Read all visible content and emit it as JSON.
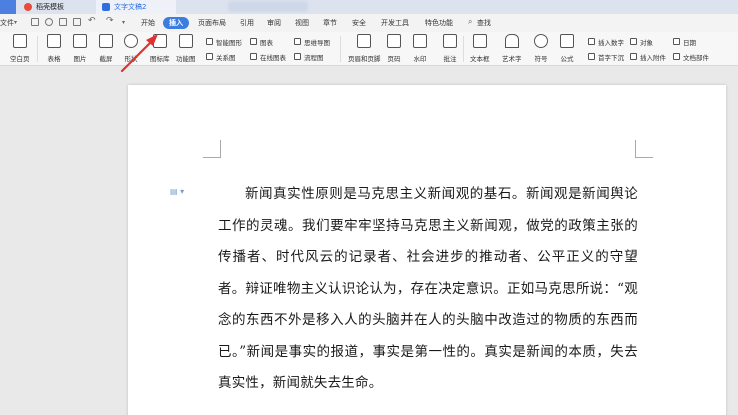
{
  "tabs": {
    "home_label": "",
    "tab1": "稻壳模板",
    "tab2": "文字文稿2"
  },
  "quick_access": {
    "file": "文件",
    "more": "▾"
  },
  "menu": {
    "items": [
      "开始",
      "插入",
      "页面布局",
      "引用",
      "审阅",
      "视图",
      "章节",
      "安全",
      "开发工具",
      "特色功能",
      "查找"
    ],
    "active": "插入"
  },
  "ribbon": {
    "blank_page": "空白页",
    "table": "表格",
    "image": "图片",
    "screenshot": "截屏",
    "shape": "形状",
    "icon_lib": "图标库",
    "func_chart": "功能图",
    "smart_shape": "智能图形",
    "relation": "关系图",
    "chart": "图表",
    "online_chart": "在线图表",
    "mindmap": "思维导图",
    "flowchart": "流程图",
    "header_footer": "页眉和页脚",
    "page_num": "页码",
    "watermark": "水印",
    "comment": "批注",
    "textbox": "文本框",
    "wordart": "艺术字",
    "symbol": "符号",
    "formula": "公式",
    "insert_number": "插入数字",
    "object": "对象",
    "date": "日期",
    "dropcap": "首字下沉",
    "attachment": "插入附件",
    "doc_part": "文档部件"
  },
  "document": {
    "paragraph": "新闻真实性原则是马克思主义新闻观的基石。新闻观是新闻舆论工作的灵魂。我们要牢牢坚持马克思主义新闻观，做党的政策主张的传播者、时代风云的记录者、社会进步的推动者、公平正义的守望者。辩证唯物主义认识论认为，存在决定意识。正如马克思所说：“观念的东西不外是移入人的头脑并在人的头脑中改造过的物质的东西而已。”新闻是事实的报道，事实是第一性的。真实是新闻的本质，失去真实性，新闻就失去生命。"
  },
  "colors": {
    "accent": "#3b7de0",
    "arrow": "#e03030"
  }
}
